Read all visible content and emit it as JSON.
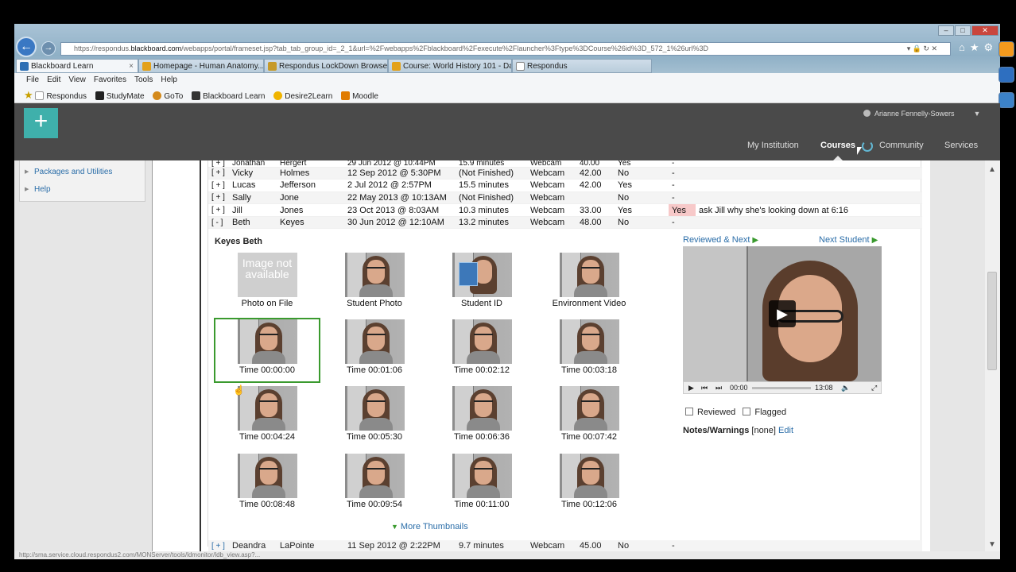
{
  "browser": {
    "url_prefix": "https://respondus.",
    "url_domain": "blackboard.com",
    "url_rest": "/webapps/portal/frameset.jsp?tab_tab_group_id=_2_1&url=%2Fwebapps%2Fblackboard%2Fexecute%2Flauncher%3Ftype%3DCourse%26id%3D_572_1%26url%3D",
    "tabs": [
      {
        "label": "Blackboard Learn"
      },
      {
        "label": "Homepage - Human Anatomy..."
      },
      {
        "label": "Respondus LockDown Browser..."
      },
      {
        "label": "Course: World History 101 - Da..."
      },
      {
        "label": "Respondus"
      }
    ],
    "menu": [
      "File",
      "Edit",
      "View",
      "Favorites",
      "Tools",
      "Help"
    ],
    "favorites": [
      "Respondus",
      "StudyMate",
      "GoTo",
      "Blackboard Learn",
      "Desire2Learn",
      "Moodle"
    ],
    "status_url": "http://sma.service.cloud.respondus2.com/MONServer/tools/ldmonitor/ldb_view.asp?..."
  },
  "bb": {
    "user": "Arianne Fennelly-Sowers",
    "nav": [
      "My Institution",
      "Courses",
      "Community",
      "Services"
    ],
    "left_menu": [
      "Packages and Utilities",
      "Help"
    ]
  },
  "rows": [
    {
      "exp": "[ + ]",
      "first": "Jonathan",
      "last": "Hergert",
      "date": "29 Jun 2012 @ 10:44PM",
      "duration": "15.9 minutes",
      "source": "Webcam",
      "score": "40.00",
      "reviewed": "Yes",
      "flag": "-",
      "note": ""
    },
    {
      "exp": "[ + ]",
      "first": "Vicky",
      "last": "Holmes",
      "date": "12 Sep 2012 @ 5:30PM",
      "duration": "(Not Finished)",
      "source": "Webcam",
      "score": "42.00",
      "reviewed": "No",
      "flag": "-",
      "note": ""
    },
    {
      "exp": "[ + ]",
      "first": "Lucas",
      "last": "Jefferson",
      "date": "2 Jul 2012 @ 2:57PM",
      "duration": "15.5 minutes",
      "source": "Webcam",
      "score": "42.00",
      "reviewed": "Yes",
      "flag": "-",
      "note": ""
    },
    {
      "exp": "[ + ]",
      "first": "Sally",
      "last": "Jone",
      "date": "22 May 2013 @ 10:13AM",
      "duration": "(Not Finished)",
      "source": "Webcam",
      "score": "",
      "reviewed": "No",
      "flag": "-",
      "note": ""
    },
    {
      "exp": "[ + ]",
      "first": "Jill",
      "last": "Jones",
      "date": "23 Oct 2013 @ 8:03AM",
      "duration": "10.3 minutes",
      "source": "Webcam",
      "score": "33.00",
      "reviewed": "Yes",
      "flag": "Yes",
      "note": "ask Jill why she's looking down at 6:16"
    },
    {
      "exp": "[ - ]",
      "first": "Beth",
      "last": "Keyes",
      "date": "30 Jun 2012 @ 12:10AM",
      "duration": "13.2 minutes",
      "source": "Webcam",
      "score": "48.00",
      "reviewed": "No",
      "flag": "-",
      "note": ""
    }
  ],
  "detail": {
    "name": "Keyes Beth",
    "no_image": "Image not available",
    "thumbs_top": [
      "Photo on File",
      "Student Photo",
      "Student ID",
      "Environment Video"
    ],
    "times": [
      "Time 00:00:00",
      "Time 00:01:06",
      "Time 00:02:12",
      "Time 00:03:18",
      "Time 00:04:24",
      "Time 00:05:30",
      "Time 00:06:36",
      "Time 00:07:42",
      "Time 00:08:48",
      "Time 00:09:54",
      "Time 00:11:00",
      "Time 00:12:06"
    ],
    "more_thumbnails": "More Thumbnails",
    "reviewed_next": "Reviewed & Next",
    "next_student": "Next Student",
    "video_current": "00:00",
    "video_total": "13:08",
    "reviewed_label": "Reviewed",
    "flagged_label": "Flagged",
    "notes_label": "Notes/Warnings",
    "notes_value": "[none]",
    "edit_label": "Edit"
  },
  "bottom_row": {
    "exp": "[ + ]",
    "first": "Deandra",
    "last": "LaPointe",
    "date": "11 Sep 2012 @ 2:22PM",
    "duration": "9.7 minutes",
    "source": "Webcam",
    "score": "45.00",
    "reviewed": "No",
    "flag": "-"
  }
}
